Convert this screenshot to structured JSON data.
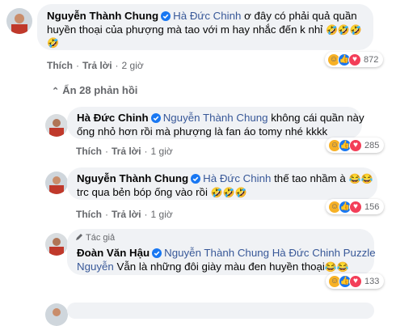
{
  "comments": [
    {
      "author": "Nguyễn Thành Chung",
      "line1": "Hà Đức Chinh",
      "line1_text": "ơ đây có phải quả quần",
      "line2": "huyền thoại của phượng mà tao với m hay nhắc đến k nhỉ",
      "line2_emoji": "🤣🤣🤣",
      "line3_emoji": "🤣",
      "like": "Thích",
      "reply": "Trả lời",
      "time": "2 giờ",
      "reaction_count": "872"
    },
    {
      "author": "Hà Đức Chinh",
      "mention": "Nguyễn Thành Chung",
      "line1_text": "không cái quần này",
      "line2": "ống nhỏ hơn rồi mà phượng là fan áo tomy nhé kkkk",
      "like": "Thích",
      "reply": "Trả lời",
      "time": "1 giờ",
      "reaction_count": "285"
    },
    {
      "author": "Nguyễn Thành Chung",
      "mention": "Hà Đức Chinh",
      "line1_text": "thế tao nhầm à",
      "line1_emoji": "😂😂",
      "line2": "trc qua bẻn bóp ống vào rồi",
      "line2_emoji": "🤣🤣🤣",
      "like": "Thích",
      "reply": "Trả lời",
      "time": "1 giờ",
      "reaction_count": "156"
    },
    {
      "author_tag": "Tác giả",
      "author": "Đoàn Văn Hậu",
      "mention": "Nguyễn Thành Chung Hà Đức Chinh Puzzle",
      "line2_mention": "Nguyễn",
      "line2_text": "Vẫn là những đôi giày màu đen huyền thoại",
      "line2_emoji": "😂😂",
      "reaction_count": "133"
    }
  ],
  "hide_replies": "Ẩn 28 phản hồi",
  "colors": {
    "bubble": "#f0f2f5",
    "link": "#385898",
    "meta": "#65676b",
    "verified": "#1877f2"
  }
}
